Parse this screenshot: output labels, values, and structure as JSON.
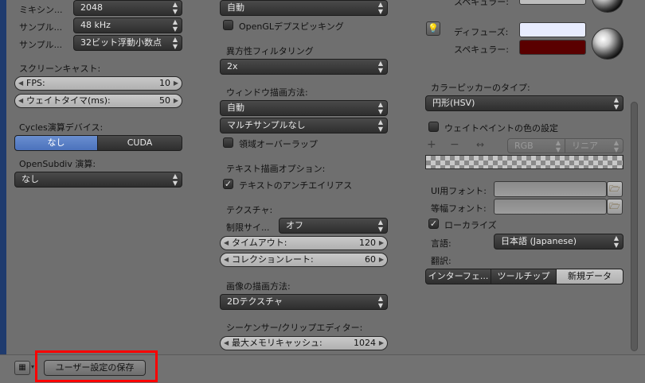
{
  "col1": {
    "mixing_label": "ミキシン...",
    "mixing_value": "2048",
    "sample_rate_label": "サンプル...",
    "sample_rate_value": "48 kHz",
    "sample_format_label": "サンプル...",
    "sample_format_value": "32ビット浮動小数点",
    "screencast_heading": "スクリーンキャスト:",
    "fps_label": "FPS:",
    "fps_value": "10",
    "wait_label": "ウェイトタイマ(ms):",
    "wait_value": "50",
    "cycles_heading": "Cycles演算デバイス:",
    "cycles_none": "なし",
    "cycles_cuda": "CUDA",
    "opensubdiv_heading": "OpenSubdiv 演算:",
    "opensubdiv_value": "なし"
  },
  "col2": {
    "top_value": "自動",
    "opengl_depth": "OpenGLデプスピッキング",
    "aniso_heading": "異方性フィルタリング",
    "aniso_value": "2x",
    "window_draw_heading": "ウィンドウ描画方法:",
    "window_draw_value": "自動",
    "multisample_value": "マルチサンプルなし",
    "region_overlap": "領域オーバーラップ",
    "text_draw_heading": "テキスト描画オプション:",
    "text_aa": "テキストのアンチエイリアス",
    "texture_heading": "テクスチャ:",
    "limit_label": "制限サイ...",
    "limit_value": "オフ",
    "timeout_label": "タイムアウト:",
    "timeout_value": "120",
    "collection_label": "コレクションレート:",
    "collection_value": "60",
    "image_draw_heading": "画像の描画方法:",
    "image_draw_value": "2Dテクスチャ",
    "sequencer_heading": "シーケンサー/クリップエディター:",
    "max_mem_label": "最大メモリキャッシュ:",
    "max_mem_value": "1024"
  },
  "col3": {
    "specular_top": "スペキュラー:",
    "diffuse_label": "ディフューズ:",
    "specular_label": "スペキュラー:",
    "diffuse_color": "#e8ecfe",
    "specular_color": "#5a0000",
    "picker_heading": "カラーピッカーのタイプ:",
    "picker_value": "円形(HSV)",
    "weight_paint": "ウェイトペイントの色の設定",
    "rgb_label": "RGB",
    "linear_label": "リニア",
    "ui_font_label": "UI用フォント:",
    "mono_font_label": "等幅フォント:",
    "localize_label": "ローカライズ",
    "language_label": "言語:",
    "language_value": "日本語 (Japanese)",
    "translate_label": "翻訳:",
    "tr_interface": "インターフェ...",
    "tr_tooltips": "ツールチップ",
    "tr_newdata": "新規データ"
  },
  "footer": {
    "save_label": "ユーザー設定の保存"
  }
}
